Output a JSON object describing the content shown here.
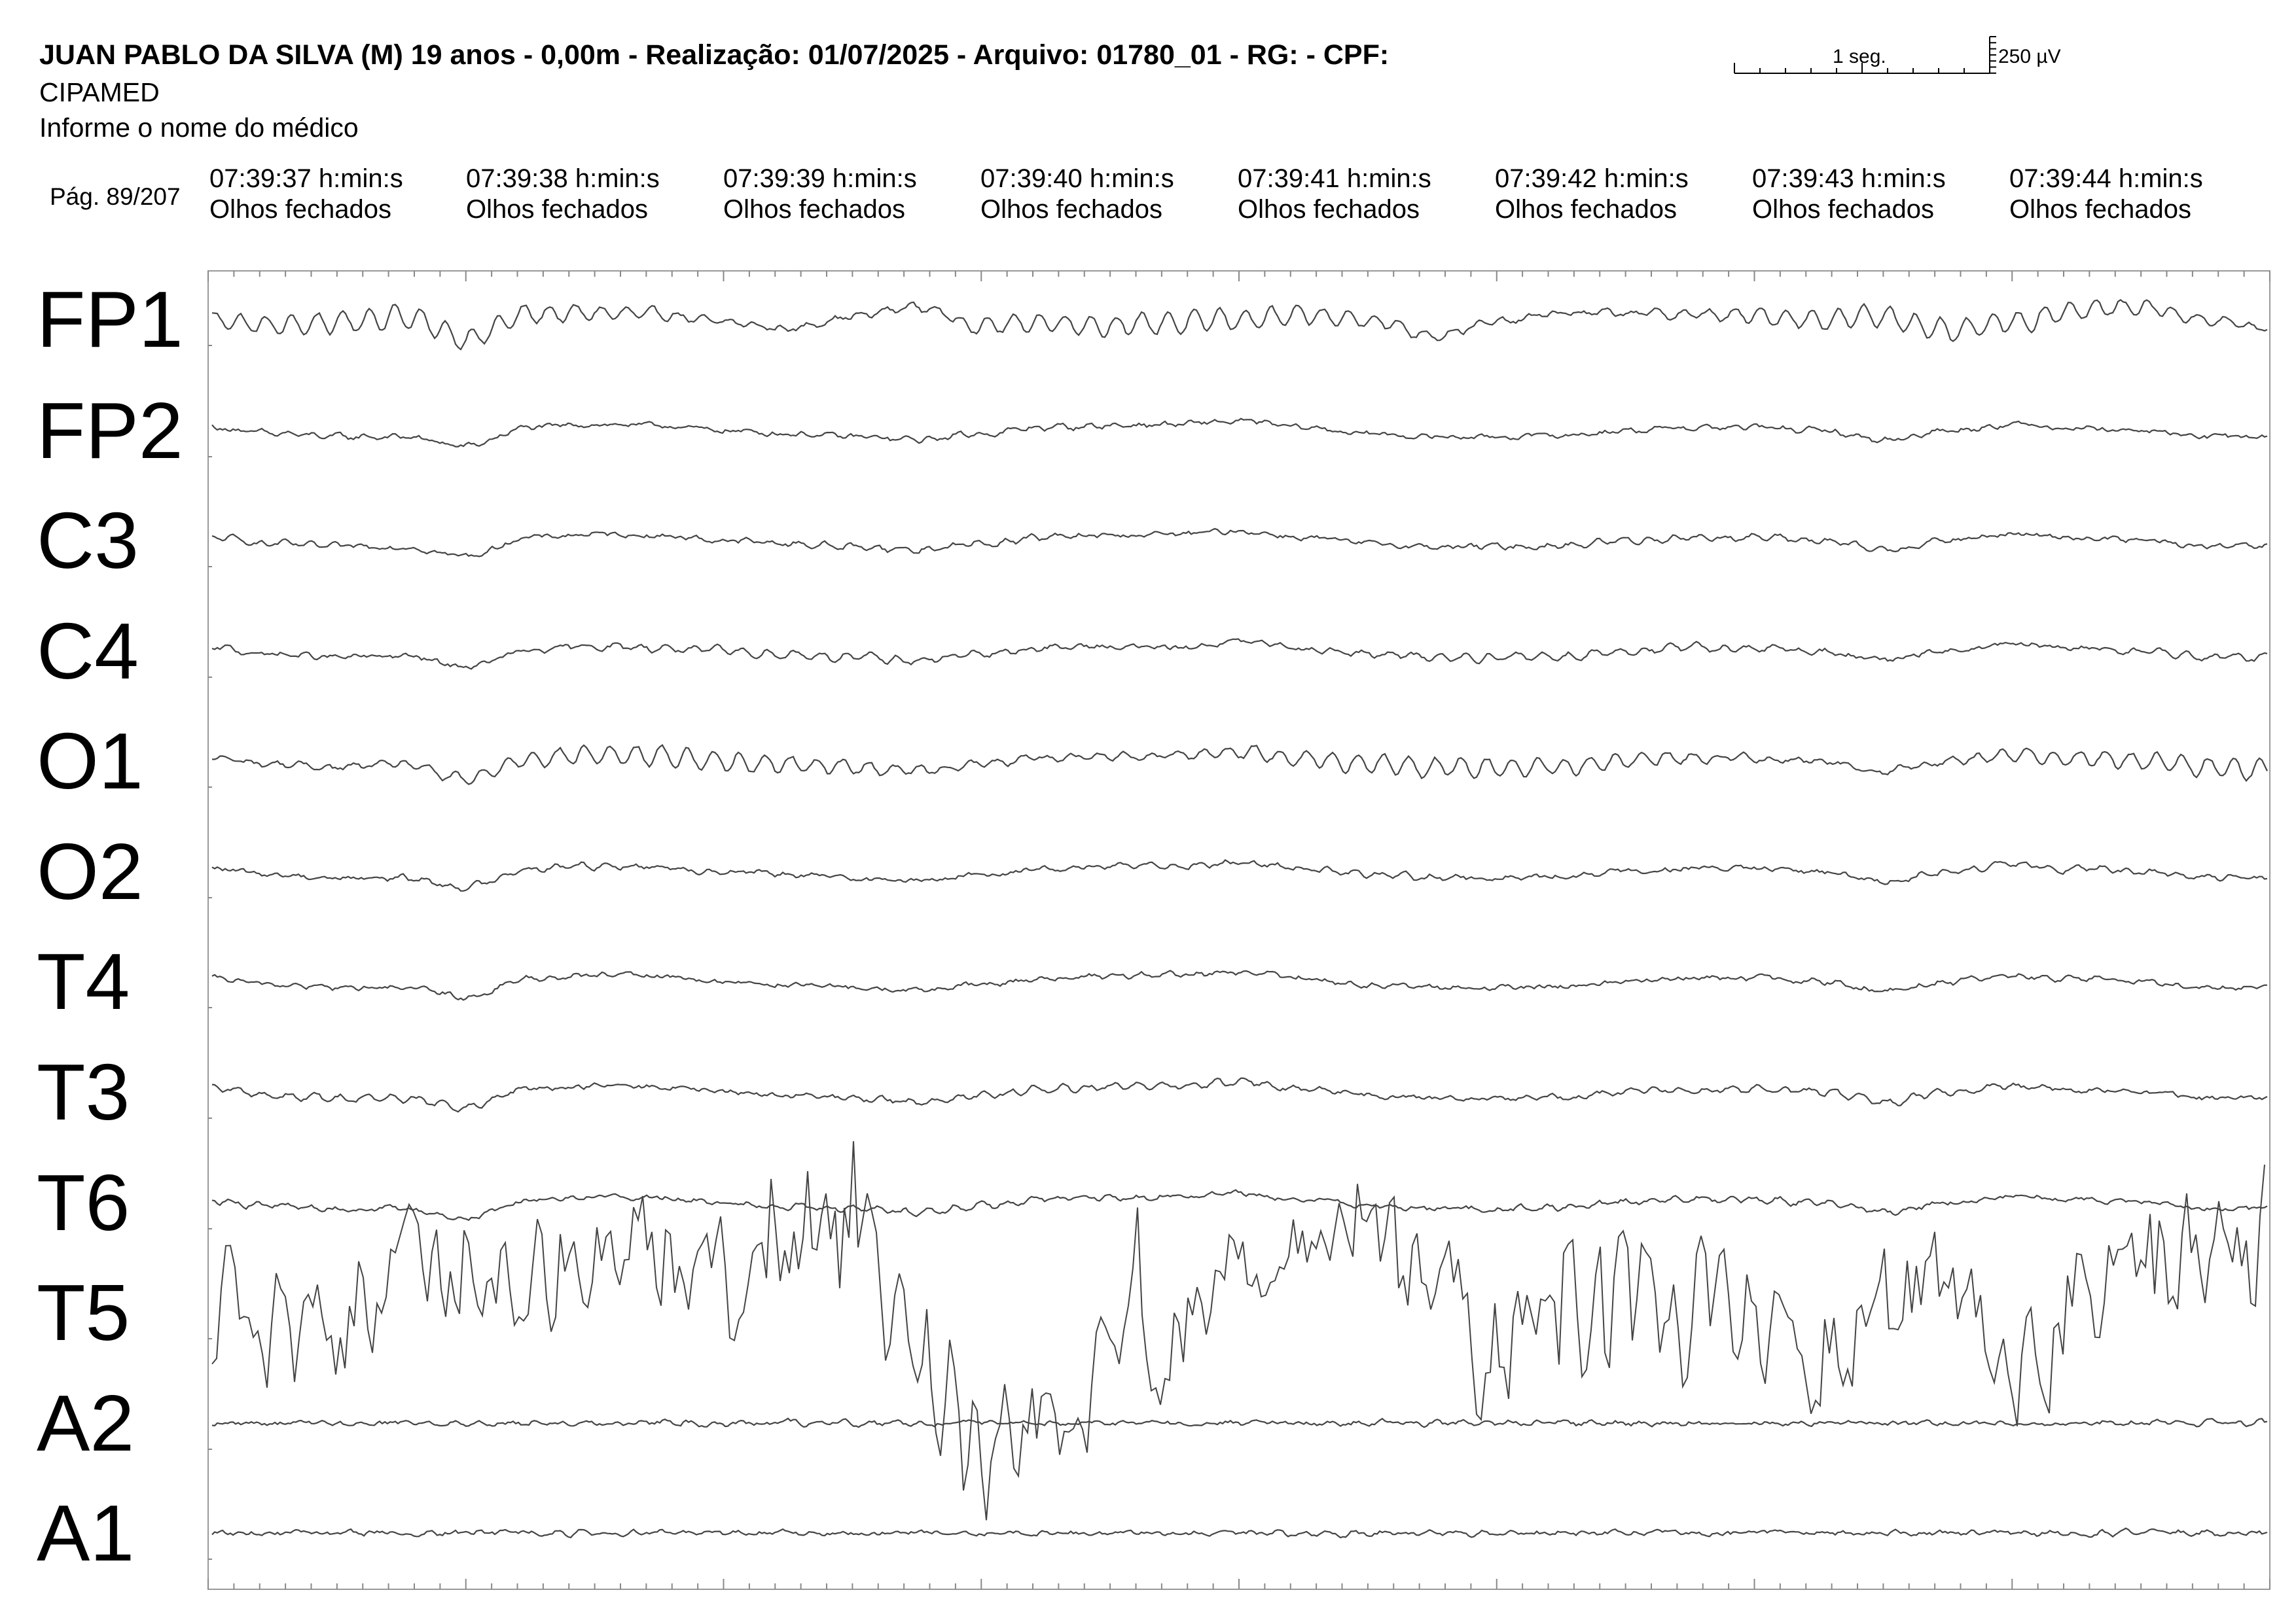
{
  "header": {
    "title": "JUAN PABLO DA SILVA (M) 19 anos - 0,00m - Realização: 01/07/2025 - Arquivo: 01780_01 - RG:  - CPF:",
    "clinic": "CIPAMED",
    "doctor": "Informe o nome do médico",
    "page": "Pág. 89/207"
  },
  "scale": {
    "time_label": "1 seg.",
    "amplitude_label": "250 µV"
  },
  "epochs": [
    {
      "time": "07:39:37 h:min:s",
      "state": "Olhos fechados"
    },
    {
      "time": "07:39:38 h:min:s",
      "state": "Olhos fechados"
    },
    {
      "time": "07:39:39 h:min:s",
      "state": "Olhos fechados"
    },
    {
      "time": "07:39:40 h:min:s",
      "state": "Olhos fechados"
    },
    {
      "time": "07:39:41 h:min:s",
      "state": "Olhos fechados"
    },
    {
      "time": "07:39:42 h:min:s",
      "state": "Olhos fechados"
    },
    {
      "time": "07:39:43 h:min:s",
      "state": "Olhos fechados"
    },
    {
      "time": "07:39:44 h:min:s",
      "state": "Olhos fechados"
    }
  ],
  "chart_data": {
    "type": "line",
    "x_unit": "s",
    "x_range": [
      0,
      8
    ],
    "y_unit": "µV",
    "grid": false,
    "channels": [
      {
        "name": "FP1",
        "offset": [
          0,
          -10,
          -5,
          5,
          -30,
          8,
          10,
          8,
          -5,
          -15,
          5,
          20,
          -10,
          -5,
          -10,
          -5,
          0,
          5,
          0,
          -25,
          -5,
          10,
          10,
          8,
          5,
          0,
          5,
          -20,
          -5,
          15,
          20,
          0,
          -15
        ],
        "alpha_amp": 18
      },
      {
        "name": "FP2",
        "offset": [
          5,
          -5,
          -10,
          -10,
          -25,
          5,
          10,
          8,
          0,
          -5,
          -10,
          -15,
          -5,
          5,
          8,
          10,
          15,
          5,
          -5,
          -10,
          -10,
          -8,
          0,
          5,
          5,
          0,
          -15,
          0,
          10,
          5,
          0,
          -10,
          -10
        ],
        "alpha_amp": 3
      },
      {
        "name": "C3",
        "offset": [
          5,
          -5,
          -10,
          -10,
          -25,
          5,
          10,
          8,
          0,
          -5,
          -10,
          -15,
          -5,
          5,
          8,
          10,
          15,
          5,
          -5,
          -10,
          -10,
          -8,
          0,
          5,
          5,
          0,
          -15,
          0,
          10,
          5,
          0,
          -10,
          -10
        ],
        "alpha_amp": 4
      },
      {
        "name": "C4",
        "offset": [
          5,
          -5,
          -10,
          -8,
          -25,
          0,
          8,
          5,
          0,
          -5,
          -10,
          -15,
          -5,
          5,
          8,
          5,
          15,
          5,
          -5,
          -10,
          -10,
          -8,
          0,
          5,
          5,
          0,
          -15,
          0,
          10,
          5,
          0,
          -10,
          -10
        ],
        "alpha_amp": 6
      },
      {
        "name": "O1",
        "offset": [
          5,
          -5,
          -10,
          -5,
          -30,
          5,
          10,
          8,
          0,
          -5,
          -10,
          -15,
          -5,
          5,
          8,
          10,
          15,
          5,
          -5,
          -10,
          -10,
          -8,
          0,
          5,
          5,
          0,
          -15,
          0,
          10,
          5,
          0,
          -10,
          -15
        ],
        "alpha_amp": 16
      },
      {
        "name": "O2",
        "offset": [
          5,
          -5,
          -10,
          -10,
          -25,
          5,
          10,
          8,
          0,
          -5,
          -10,
          -15,
          -5,
          5,
          8,
          10,
          15,
          5,
          -5,
          -10,
          -10,
          -8,
          0,
          5,
          5,
          0,
          -15,
          0,
          10,
          5,
          0,
          -10,
          -10
        ],
        "alpha_amp": 4
      },
      {
        "name": "T4",
        "offset": [
          5,
          -5,
          -10,
          -10,
          -25,
          5,
          10,
          8,
          0,
          -5,
          -10,
          -15,
          -5,
          5,
          8,
          10,
          15,
          5,
          -5,
          -10,
          -10,
          -8,
          0,
          5,
          5,
          0,
          -15,
          0,
          10,
          5,
          0,
          -10,
          -10
        ],
        "alpha_amp": 3
      },
      {
        "name": "T3",
        "offset": [
          5,
          -5,
          -10,
          -10,
          -25,
          5,
          10,
          8,
          0,
          -5,
          -10,
          -15,
          -5,
          5,
          8,
          10,
          15,
          5,
          -5,
          -10,
          -10,
          -8,
          0,
          5,
          5,
          0,
          -15,
          0,
          10,
          5,
          0,
          -10,
          -10
        ],
        "alpha_amp": 5
      },
      {
        "name": "T6",
        "offset": [
          5,
          -5,
          -10,
          -10,
          -25,
          5,
          10,
          8,
          0,
          -5,
          -10,
          -15,
          -5,
          5,
          8,
          10,
          15,
          5,
          -5,
          -10,
          -10,
          -8,
          0,
          5,
          5,
          0,
          -15,
          0,
          10,
          5,
          0,
          -10,
          -10
        ],
        "alpha_amp": 4
      },
      {
        "name": "T5",
        "offset": [
          10,
          0,
          -10,
          60,
          100,
          70,
          120,
          110,
          60,
          100,
          150,
          -20,
          -200,
          -150,
          -80,
          -20,
          60,
          150,
          110,
          40,
          -40,
          -20,
          20,
          0,
          -20,
          -30,
          10,
          40,
          -80,
          20,
          60,
          120,
          100
        ],
        "alpha_amp": 55
      },
      {
        "name": "A2",
        "offset": [
          0,
          0,
          0,
          0,
          0,
          0,
          0,
          0,
          0,
          0,
          0,
          0,
          0,
          0,
          0,
          0,
          0,
          0,
          0,
          0,
          0,
          0,
          0,
          0,
          0,
          0,
          0,
          0,
          0,
          0,
          0,
          0,
          0
        ],
        "alpha_amp": 3
      },
      {
        "name": "A1",
        "offset": [
          0,
          0,
          0,
          0,
          0,
          0,
          0,
          0,
          0,
          0,
          0,
          0,
          0,
          0,
          0,
          0,
          0,
          0,
          0,
          0,
          0,
          0,
          0,
          0,
          0,
          0,
          0,
          0,
          0,
          0,
          0,
          0,
          0
        ],
        "alpha_amp": 3
      }
    ]
  }
}
